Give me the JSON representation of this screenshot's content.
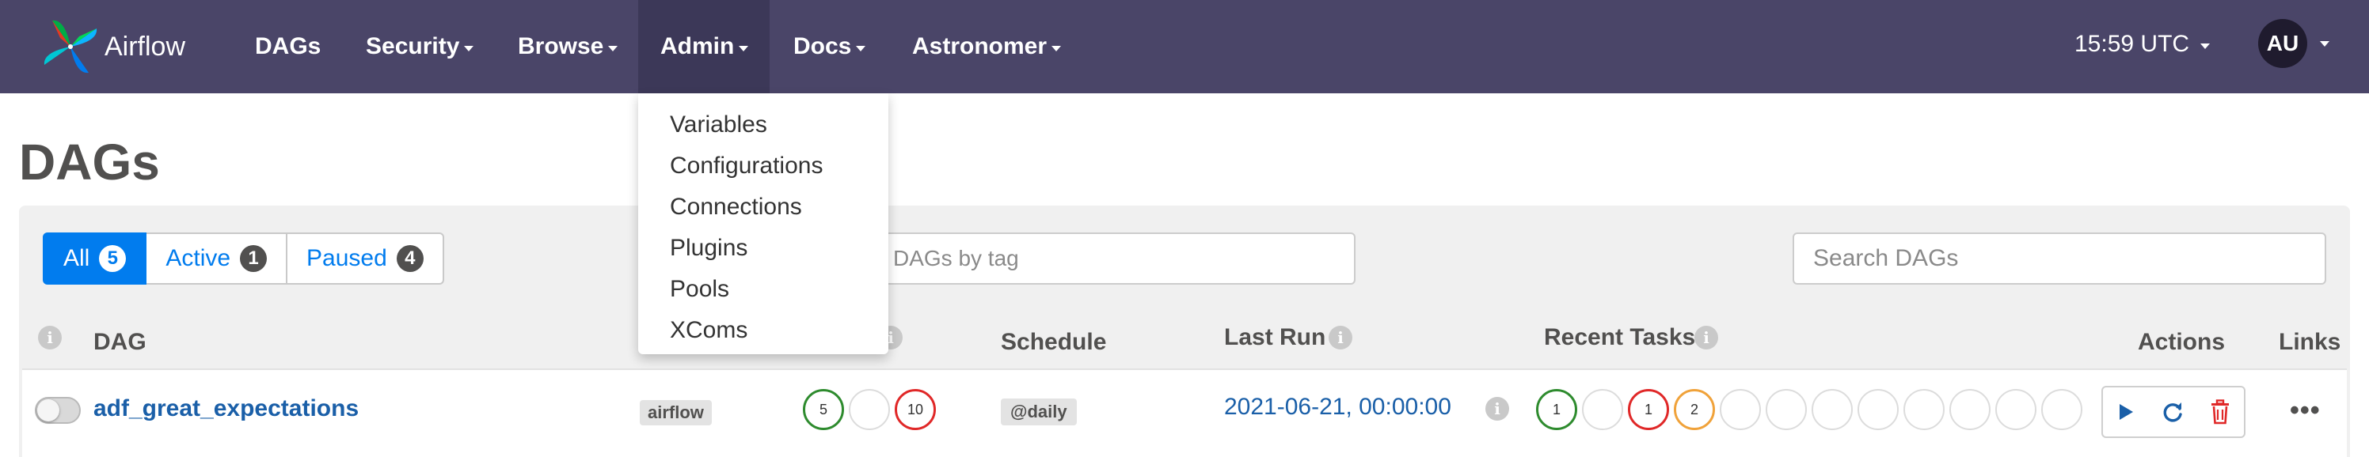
{
  "navbar": {
    "brand": "Airflow",
    "items": [
      {
        "label": "DAGs"
      },
      {
        "label": "Security"
      },
      {
        "label": "Browse"
      },
      {
        "label": "Admin"
      },
      {
        "label": "Docs"
      },
      {
        "label": "Astronomer"
      }
    ],
    "clock": "15:59 UTC",
    "avatar": "AU"
  },
  "admin_menu": [
    "Variables",
    "Configurations",
    "Connections",
    "Plugins",
    "Pools",
    "XComs"
  ],
  "page": {
    "title": "DAGs"
  },
  "filters": [
    {
      "label": "All",
      "count": "5"
    },
    {
      "label": "Active",
      "count": "1"
    },
    {
      "label": "Paused",
      "count": "4"
    }
  ],
  "tag_filter": {
    "placeholder": "DAGs by tag"
  },
  "search": {
    "placeholder": "Search DAGs"
  },
  "table": {
    "headers": {
      "dag": "DAG",
      "schedule": "Schedule",
      "last_run": "Last Run",
      "recent_tasks": "Recent Tasks",
      "actions": "Actions",
      "links": "Links"
    },
    "rows": [
      {
        "dag_id": "adf_great_expectations",
        "owner": "airflow",
        "runs": [
          "5",
          "",
          "10"
        ],
        "schedule": "@daily",
        "last_run": "2021-06-21, 00:00:00",
        "recent_tasks": [
          "1",
          "",
          "1",
          "2",
          "",
          "",
          "",
          "",
          "",
          "",
          "",
          ""
        ]
      }
    ]
  },
  "colors": {
    "navbar": "#4a4568",
    "accent": "#017cee",
    "success": "#2e8b2e",
    "failed": "#e02828",
    "upstream_failed": "#f0a23a",
    "delete": "#e02828"
  },
  "icons": {
    "trigger": "play-icon",
    "refresh": "refresh-icon",
    "delete": "trash-icon",
    "info": "info-icon",
    "more": "more-dots-icon"
  }
}
